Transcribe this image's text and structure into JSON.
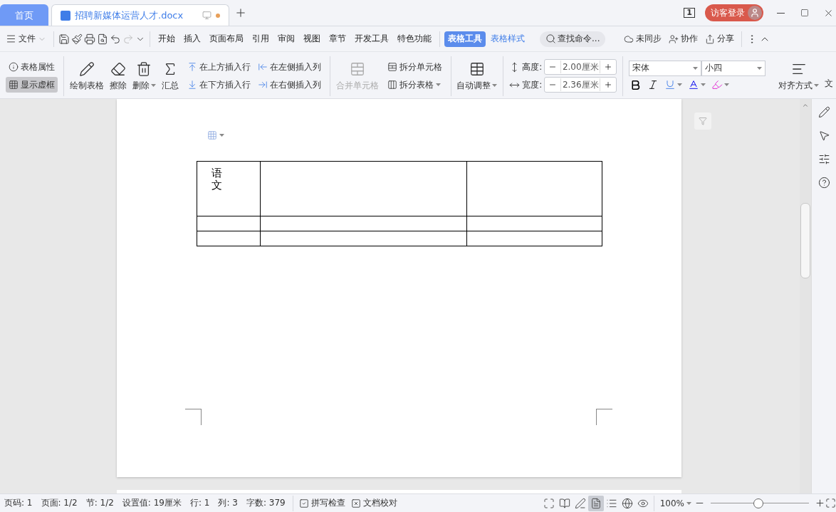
{
  "tabs": [
    {
      "label": "首页",
      "kind": "home",
      "selected": false,
      "unsaved": false
    },
    {
      "label": "招聘新媒体运营人才.docx",
      "kind": "document",
      "selected": true,
      "unsaved": true
    }
  ],
  "title_bar": {
    "window_count": "1",
    "login": "访客登录"
  },
  "menu": {
    "file": "文件",
    "tabs": [
      {
        "label": "开始",
        "selected": false,
        "contextual": false
      },
      {
        "label": "插入",
        "selected": false,
        "contextual": false
      },
      {
        "label": "页面布局",
        "selected": false,
        "contextual": false
      },
      {
        "label": "引用",
        "selected": false,
        "contextual": false
      },
      {
        "label": "审阅",
        "selected": false,
        "contextual": false
      },
      {
        "label": "视图",
        "selected": false,
        "contextual": false
      },
      {
        "label": "章节",
        "selected": false,
        "contextual": false
      },
      {
        "label": "开发工具",
        "selected": false,
        "contextual": false
      },
      {
        "label": "特色功能",
        "selected": false,
        "contextual": false
      },
      {
        "label": "表格工具",
        "selected": true,
        "contextual": true
      },
      {
        "label": "表格样式",
        "selected": false,
        "contextual": true
      }
    ],
    "search": {
      "placeholder": "查找命令..."
    },
    "actions": [
      {
        "label": "未同步",
        "kind": "sync"
      },
      {
        "label": "协作",
        "kind": "collab"
      },
      {
        "label": "分享",
        "kind": "share"
      }
    ]
  },
  "ribbon": {
    "view_toggles": [
      {
        "label": "表格属性",
        "kind": "props",
        "on": false
      },
      {
        "label": "显示虚框",
        "kind": "grid",
        "on": true
      }
    ],
    "tools": [
      {
        "label": "绘制表格",
        "kind": "draw",
        "dropdown": false
      },
      {
        "label": "擦除",
        "kind": "erase",
        "dropdown": false
      },
      {
        "label": "删除",
        "kind": "delete",
        "dropdown": true
      },
      {
        "label": "汇总",
        "kind": "sum",
        "dropdown": false
      }
    ],
    "insert": [
      {
        "label": "在上方插入行",
        "kind": "above"
      },
      {
        "label": "在左侧插入列",
        "kind": "left"
      },
      {
        "label": "在下方插入行",
        "kind": "below"
      },
      {
        "label": "在右侧插入列",
        "kind": "right"
      }
    ],
    "merge": {
      "label": "合并单元格",
      "disabled": true
    },
    "split": [
      {
        "label": "拆分单元格",
        "dropdown": false
      },
      {
        "label": "拆分表格",
        "dropdown": true
      }
    ],
    "autofit": {
      "label": "自动调整",
      "dropdown": true
    },
    "size": [
      {
        "label": "高度:",
        "value": "2.00厘米",
        "kind": "height"
      },
      {
        "label": "宽度:",
        "value": "2.36厘米",
        "kind": "width"
      }
    ],
    "font": {
      "family": "宋体",
      "size": "小四"
    },
    "align": {
      "label": "对齐方式",
      "dropdown": true
    },
    "cut_label": "文"
  },
  "document": {
    "table": {
      "rows": [
        {
          "cells": [
            {
              "text": "语文"
            },
            {},
            {}
          ]
        },
        {
          "cells": [
            {},
            {},
            {}
          ]
        },
        {
          "cells": [
            {},
            {},
            {}
          ]
        }
      ]
    }
  },
  "status_bar": {
    "items": [
      "页码: 1",
      "页面: 1/2",
      "节: 1/2",
      "设置值: 19厘米",
      "行: 1",
      "列: 3",
      "字数: 379"
    ],
    "checks": [
      {
        "label": "拼写检查",
        "kind": "spell"
      },
      {
        "label": "文档校对",
        "kind": "proof"
      }
    ],
    "views": [
      {
        "kind": "fullscreen",
        "selected": false
      },
      {
        "kind": "read",
        "selected": false
      },
      {
        "kind": "edit",
        "selected": false
      },
      {
        "kind": "page",
        "selected": true
      },
      {
        "kind": "outline",
        "selected": false
      },
      {
        "kind": "web",
        "selected": false
      },
      {
        "kind": "protect",
        "selected": false
      }
    ],
    "zoom": {
      "value": "100%",
      "level": 0.48
    }
  }
}
